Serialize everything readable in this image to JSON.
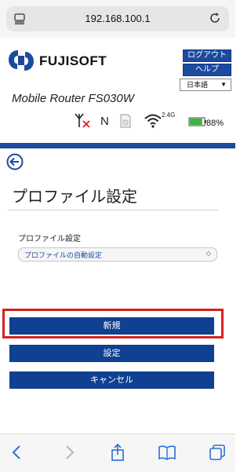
{
  "browser": {
    "url": "192.168.100.1",
    "toolbar_icons": [
      "back-icon",
      "forward-icon",
      "share-icon",
      "bookmarks-icon",
      "tabs-icon"
    ]
  },
  "header": {
    "brand": "FUJISOFT",
    "model": "Mobile Router FS030W",
    "logout_label": "ログアウト",
    "help_label": "ヘルプ",
    "language": "日本語"
  },
  "status": {
    "network_letter": "N",
    "wifi_band": "2.4G",
    "battery_percent": "88%",
    "battery_level": 0.88
  },
  "colors": {
    "brand_blue": "#1b4a9e",
    "button_blue": "#0f4091",
    "highlight_red": "#d62020",
    "battery_green": "#3cb53c"
  },
  "page": {
    "title": "プロファイル設定",
    "field_label": "プロファイル設定",
    "select_value": "プロファイルの自動設定"
  },
  "actions": {
    "new_label": "新規",
    "set_label": "設定",
    "cancel_label": "キャンセル"
  }
}
